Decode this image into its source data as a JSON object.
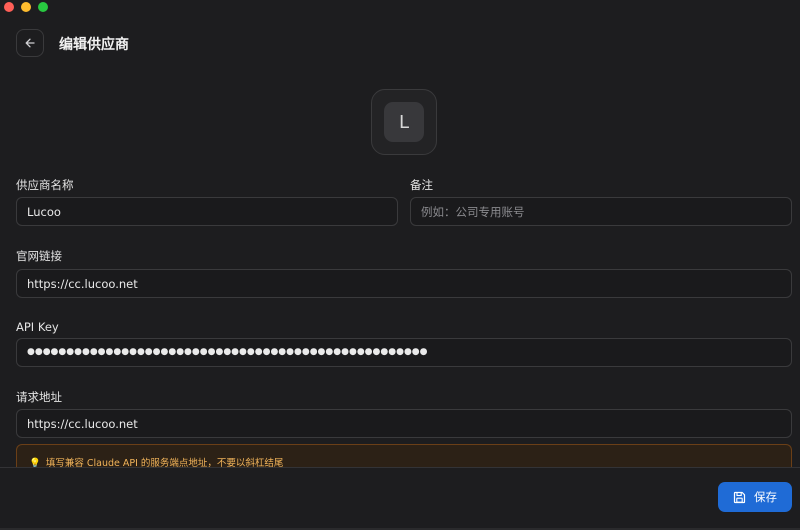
{
  "header": {
    "title": "编辑供应商"
  },
  "avatar": {
    "letter": "L"
  },
  "form": {
    "name": {
      "label": "供应商名称",
      "value": "Lucoo"
    },
    "note": {
      "label": "备注",
      "value": "",
      "placeholder": "例如：公司专用账号"
    },
    "website": {
      "label": "官网链接",
      "value": "https://cc.lucoo.net"
    },
    "api_key": {
      "label": "API Key",
      "value": "●●●●●●●●●●●●●●●●●●●●●●●●●●●●●●●●●●●●●●●●●●●●●●●●●●●"
    },
    "endpoint": {
      "label": "请求地址",
      "value": "https://cc.lucoo.net"
    }
  },
  "hint": {
    "icon": "lightbulb-icon",
    "text": "填写兼容 Claude API 的服务端点地址，不要以斜杠结尾"
  },
  "footer": {
    "save_label": "保存",
    "save_icon": "floppy-disk-icon"
  },
  "colors": {
    "accent": "#1f6bd6",
    "hint_text": "#f0b35a"
  }
}
